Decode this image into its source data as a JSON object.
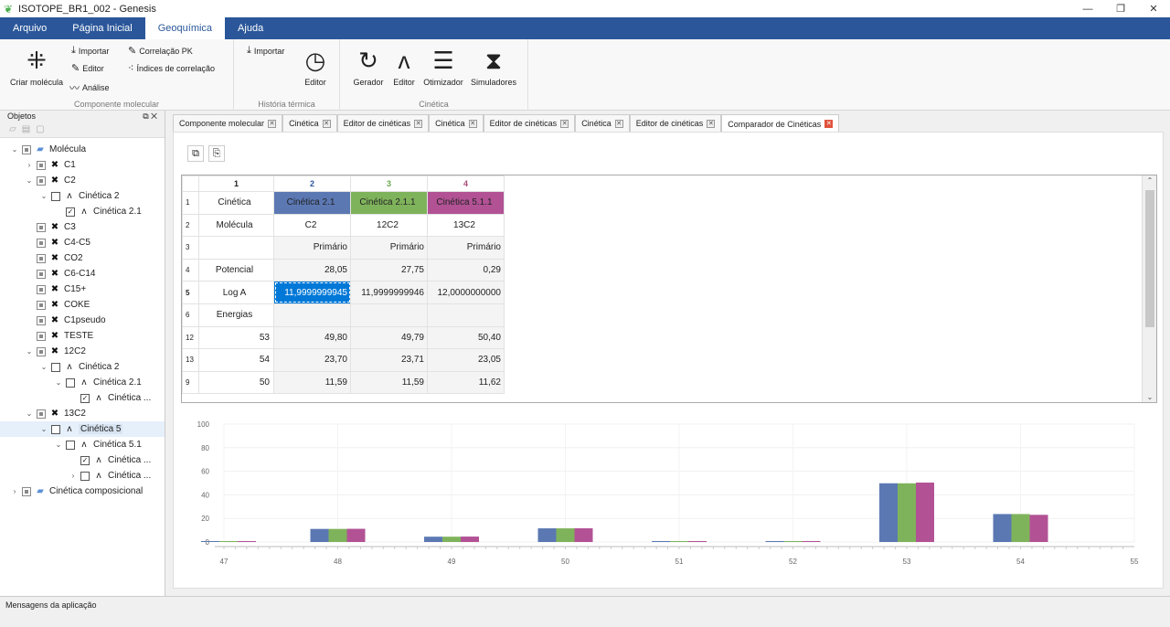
{
  "window": {
    "title": "ISOTOPE_BR1_002 - Genesis",
    "minimize": "—",
    "maximize": "❐",
    "close": "✕"
  },
  "menu": [
    "Arquivo",
    "Página Inicial",
    "Geoquímica",
    "Ajuda"
  ],
  "ribbon": {
    "criar_molecula": "Criar molécula",
    "importar": "Importar",
    "editor": "Editor",
    "analise": "Análise",
    "correlacao_pk": "Correlação PK",
    "indices_correlacao": "Índices de correlação",
    "group_componente": "Componente molecular",
    "importar2": "Importar",
    "editor2": "Editor",
    "group_historia": "História térmica",
    "gerador": "Gerador",
    "editor3": "Editor",
    "otimizador": "Otimizador",
    "simuladores": "Simuladores",
    "group_cinetica": "Cinética"
  },
  "panel": {
    "title": "Objetos",
    "tree": [
      {
        "label": "Molécula",
        "level": 0,
        "exp": "⌄",
        "cb": "part",
        "icon": "folder"
      },
      {
        "label": "C1",
        "level": 1,
        "exp": "›",
        "cb": "part",
        "icon": "mol"
      },
      {
        "label": "C2",
        "level": 1,
        "exp": "⌄",
        "cb": "part",
        "icon": "mol"
      },
      {
        "label": "Cinética 2",
        "level": 2,
        "exp": "⌄",
        "cb": "none",
        "icon": "kin"
      },
      {
        "label": "Cinética 2.1",
        "level": 3,
        "exp": "",
        "cb": "check",
        "icon": "kin"
      },
      {
        "label": "C3",
        "level": 1,
        "exp": "",
        "cb": "part",
        "icon": "mol"
      },
      {
        "label": "C4-C5",
        "level": 1,
        "exp": "",
        "cb": "part",
        "icon": "mol"
      },
      {
        "label": "CO2",
        "level": 1,
        "exp": "",
        "cb": "part",
        "icon": "mol"
      },
      {
        "label": "C6-C14",
        "level": 1,
        "exp": "",
        "cb": "part",
        "icon": "mol"
      },
      {
        "label": "C15+",
        "level": 1,
        "exp": "",
        "cb": "part",
        "icon": "mol"
      },
      {
        "label": "COKE",
        "level": 1,
        "exp": "",
        "cb": "part",
        "icon": "mol"
      },
      {
        "label": "C1pseudo",
        "level": 1,
        "exp": "",
        "cb": "part",
        "icon": "mol"
      },
      {
        "label": "TESTE",
        "level": 1,
        "exp": "",
        "cb": "part",
        "icon": "mol"
      },
      {
        "label": "12C2",
        "level": 1,
        "exp": "⌄",
        "cb": "part",
        "icon": "mol"
      },
      {
        "label": "Cinética 2",
        "level": 2,
        "exp": "⌄",
        "cb": "none",
        "icon": "kin"
      },
      {
        "label": "Cinética 2.1",
        "level": 3,
        "exp": "⌄",
        "cb": "none",
        "icon": "kin"
      },
      {
        "label": "Cinética ...",
        "level": 4,
        "exp": "",
        "cb": "check",
        "icon": "kin"
      },
      {
        "label": "13C2",
        "level": 1,
        "exp": "⌄",
        "cb": "part",
        "icon": "mol"
      },
      {
        "label": "Cinética 5",
        "level": 2,
        "exp": "⌄",
        "cb": "none",
        "icon": "kin",
        "sel": true
      },
      {
        "label": "Cinética 5.1",
        "level": 3,
        "exp": "⌄",
        "cb": "none",
        "icon": "kin"
      },
      {
        "label": "Cinética ...",
        "level": 4,
        "exp": "",
        "cb": "check",
        "icon": "kin"
      },
      {
        "label": "Cinética ...",
        "level": 4,
        "exp": "›",
        "cb": "none",
        "icon": "kin"
      },
      {
        "label": "Cinética composicional",
        "level": 0,
        "exp": "›",
        "cb": "part",
        "icon": "folder"
      }
    ]
  },
  "tabs": [
    {
      "label": "Componente molecular",
      "active": false
    },
    {
      "label": "Cinética",
      "active": false
    },
    {
      "label": "Editor de cinéticas",
      "active": false
    },
    {
      "label": "Cinética",
      "active": false
    },
    {
      "label": "Editor de cinéticas",
      "active": false
    },
    {
      "label": "Cinética",
      "active": false
    },
    {
      "label": "Editor de cinéticas",
      "active": false
    },
    {
      "label": "Comparador de Cinéticas",
      "active": true
    }
  ],
  "grid": {
    "col_headers": [
      "1",
      "2",
      "3",
      "4"
    ],
    "col_header_colors": [
      "#222222",
      "#2b579a",
      "#6aa84f",
      "#a64d79"
    ],
    "rows": [
      {
        "rh": "1",
        "cells": [
          "Cinética",
          "Cinética 2.1",
          "Cinética 2.1.1",
          "Cinética 5.1.1"
        ]
      },
      {
        "rh": "2",
        "cells": [
          "Molécula",
          "C2",
          "12C2",
          "13C2"
        ]
      },
      {
        "rh": "3",
        "cells": [
          "",
          "Primário",
          "Primário",
          "Primário"
        ]
      },
      {
        "rh": "4",
        "cells": [
          "Potencial",
          "28,05",
          "27,75",
          "0,29"
        ]
      },
      {
        "rh": "5",
        "cells": [
          "Log A",
          "11,9999999945",
          "11,9999999946",
          "12,0000000000"
        ]
      },
      {
        "rh": "6",
        "cells": [
          "Energias",
          "",
          "",
          ""
        ]
      },
      {
        "rh": "12",
        "cells": [
          "53",
          "49,80",
          "49,79",
          "50,40"
        ]
      },
      {
        "rh": "13",
        "cells": [
          "54",
          "23,70",
          "23,71",
          "23,05"
        ]
      },
      {
        "rh": "9",
        "cells": [
          "50",
          "11,59",
          "11,59",
          "11,62"
        ]
      }
    ]
  },
  "colors": {
    "series1": "#5b78b3",
    "series2": "#7fb35b",
    "series3": "#b25295",
    "selection": "#0078d7",
    "ribbon_blue": "#2b579a"
  },
  "chart_data": {
    "type": "bar",
    "categories": [
      "47",
      "48",
      "49",
      "50",
      "51",
      "52",
      "53",
      "54",
      "55"
    ],
    "series": [
      {
        "values": [
          0.3,
          11.1,
          4.5,
          11.59,
          0.8,
          0.5,
          49.8,
          23.7,
          0
        ]
      },
      {
        "values": [
          0.3,
          11.1,
          4.5,
          11.59,
          0.8,
          0.5,
          49.79,
          23.71,
          0
        ]
      },
      {
        "values": [
          0.3,
          11.2,
          4.6,
          11.62,
          0.8,
          0.5,
          50.4,
          23.05,
          0
        ]
      }
    ],
    "yticks": [
      "100",
      "80",
      "60",
      "40",
      "20",
      "0"
    ],
    "ylim": [
      0,
      100
    ],
    "grid": true
  },
  "status": "Mensagens da aplicação"
}
